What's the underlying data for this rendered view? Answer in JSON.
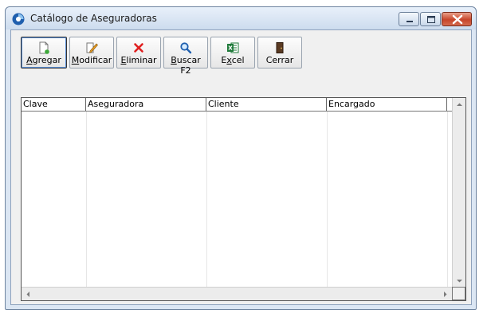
{
  "window": {
    "title": "Catálogo de Aseguradoras",
    "icon": "app-circle-icon",
    "controls": [
      "minimize-icon",
      "maximize-icon",
      "close-icon"
    ]
  },
  "toolbar": {
    "buttons": [
      {
        "id": "agregar",
        "hotkey": "A",
        "rest": "gregar",
        "icon": "new-document-icon"
      },
      {
        "id": "modificar",
        "hotkey": "M",
        "rest": "odificar",
        "icon": "edit-pencil-icon"
      },
      {
        "id": "eliminar",
        "hotkey": "E",
        "rest": "liminar",
        "icon": "red-x-icon"
      },
      {
        "id": "buscar",
        "hotkey": "B",
        "rest": "uscar F2",
        "icon": "magnifier-icon"
      },
      {
        "id": "excel",
        "pre": "E",
        "hotkey": "x",
        "rest": "cel",
        "icon": "excel-icon"
      },
      {
        "id": "cerrar",
        "label": "Cerrar",
        "icon": "door-icon"
      }
    ]
  },
  "grid": {
    "columns": [
      "Clave",
      "Aseguradora",
      "Cliente",
      "Encargado"
    ],
    "rows": []
  },
  "colors": {
    "titlebar": "#d6e3f2",
    "close_button": "#c7452a",
    "excel_green": "#1f7a3a"
  }
}
